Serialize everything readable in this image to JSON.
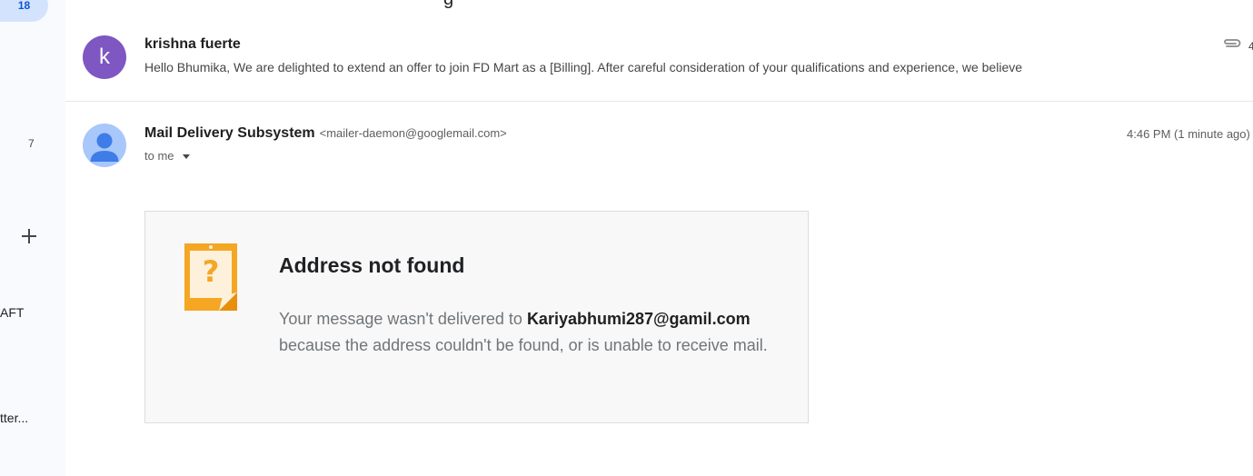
{
  "sidebar": {
    "badge_count": "18",
    "count": "7",
    "labels": [
      "AFT",
      "tter..."
    ]
  },
  "top_partial_text": "g",
  "thread_preview": {
    "avatar_letter": "k",
    "sender": "krishna fuerte",
    "snippet": "Hello Bhumika, We are delighted to extend an offer to join FD Mart as a [Billing]. After careful consideration of your qualifications and experience, we believe",
    "attachment_icon": "paperclip-icon",
    "edge_glyph": "4"
  },
  "message": {
    "sender_name": "Mail Delivery Subsystem",
    "sender_email": "<mailer-daemon@googlemail.com>",
    "recipient": "to me",
    "time": "4:46 PM (1 minute ago)"
  },
  "bounce": {
    "icon": "question-mark-note-icon",
    "title": "Address not found",
    "body_prefix": "Your message wasn't delivered to ",
    "address": "Kariyabhumi287@gamil.com",
    "body_suffix": " because the address couldn't be found, or is unable to receive mail."
  },
  "colors": {
    "avatar_purple": "#7e57c2",
    "avatar_blue": "#a8c7fa",
    "warning_orange": "#f5a623"
  }
}
